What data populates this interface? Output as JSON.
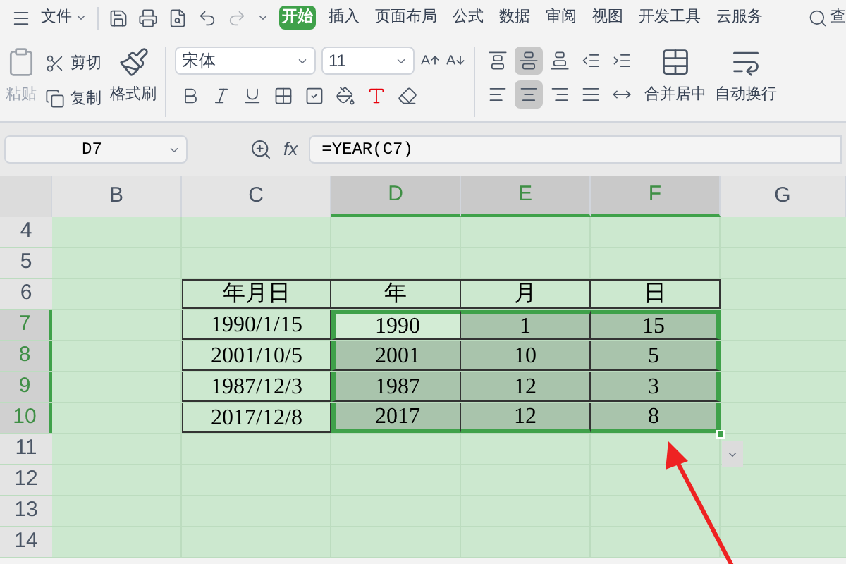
{
  "menu": {
    "file": "文件",
    "tabs": [
      {
        "label": "开始",
        "selected": true
      },
      {
        "label": "插入",
        "selected": false
      },
      {
        "label": "页面布局",
        "selected": false
      },
      {
        "label": "公式",
        "selected": false
      },
      {
        "label": "数据",
        "selected": false
      },
      {
        "label": "审阅",
        "selected": false
      },
      {
        "label": "视图",
        "selected": false
      },
      {
        "label": "开发工具",
        "selected": false
      },
      {
        "label": "云服务",
        "selected": false
      }
    ],
    "search": "查"
  },
  "clipboard": {
    "paste": {
      "label": "粘贴",
      "disabled": true
    },
    "cut": "剪切",
    "copy": "复制",
    "format_painter": "格式刷"
  },
  "font": {
    "name": "宋体",
    "size": "11"
  },
  "align_buttons": [
    {
      "kind": "top",
      "selected": false
    },
    {
      "kind": "middle",
      "selected": true
    },
    {
      "kind": "bottom",
      "selected": false
    },
    {
      "kind": "outdent",
      "selected": false
    },
    {
      "kind": "indent",
      "selected": false
    },
    {
      "kind": "left",
      "selected": false
    },
    {
      "kind": "center",
      "selected": true
    },
    {
      "kind": "right",
      "selected": false
    },
    {
      "kind": "justify",
      "selected": false
    },
    {
      "kind": "distribute",
      "selected": false
    }
  ],
  "merge": "合并居中",
  "wrap": "自动换行",
  "formula_bar": {
    "cell": "D7",
    "fx": "fx",
    "formula": "=YEAR(C7)"
  },
  "sheet": {
    "columns": [
      {
        "label": "B",
        "selected": false
      },
      {
        "label": "C",
        "selected": false
      },
      {
        "label": "D",
        "selected": true
      },
      {
        "label": "E",
        "selected": true
      },
      {
        "label": "F",
        "selected": true
      },
      {
        "label": "G",
        "selected": false
      }
    ],
    "rows": [
      {
        "label": "4",
        "selected": false
      },
      {
        "label": "5",
        "selected": false
      },
      {
        "label": "6",
        "selected": false,
        "cells": [
          {
            "value": "年月日",
            "selected": false,
            "active": false
          },
          {
            "value": "年",
            "selected": false,
            "active": false
          },
          {
            "value": "月",
            "selected": false,
            "active": false
          },
          {
            "value": "日",
            "selected": false,
            "active": false
          }
        ]
      },
      {
        "label": "7",
        "selected": true,
        "cells": [
          {
            "value": "1990/1/15",
            "selected": false,
            "active": false
          },
          {
            "value": "1990",
            "selected": true,
            "active": true
          },
          {
            "value": "1",
            "selected": true,
            "active": false
          },
          {
            "value": "15",
            "selected": true,
            "active": false
          }
        ]
      },
      {
        "label": "8",
        "selected": true,
        "cells": [
          {
            "value": "2001/10/5",
            "selected": false,
            "active": false
          },
          {
            "value": "2001",
            "selected": true,
            "active": false
          },
          {
            "value": "10",
            "selected": true,
            "active": false
          },
          {
            "value": "5",
            "selected": true,
            "active": false
          }
        ]
      },
      {
        "label": "9",
        "selected": true,
        "cells": [
          {
            "value": "1987/12/3",
            "selected": false,
            "active": false
          },
          {
            "value": "1987",
            "selected": true,
            "active": false
          },
          {
            "value": "12",
            "selected": true,
            "active": false
          },
          {
            "value": "3",
            "selected": true,
            "active": false
          }
        ]
      },
      {
        "label": "10",
        "selected": true,
        "cells": [
          {
            "value": "2017/12/8",
            "selected": false,
            "active": false
          },
          {
            "value": "2017",
            "selected": true,
            "active": false
          },
          {
            "value": "12",
            "selected": true,
            "active": false
          },
          {
            "value": "8",
            "selected": true,
            "active": false
          }
        ]
      },
      {
        "label": "11",
        "selected": false
      },
      {
        "label": "12",
        "selected": false
      },
      {
        "label": "13",
        "selected": false
      },
      {
        "label": "14",
        "selected": false
      }
    ]
  }
}
